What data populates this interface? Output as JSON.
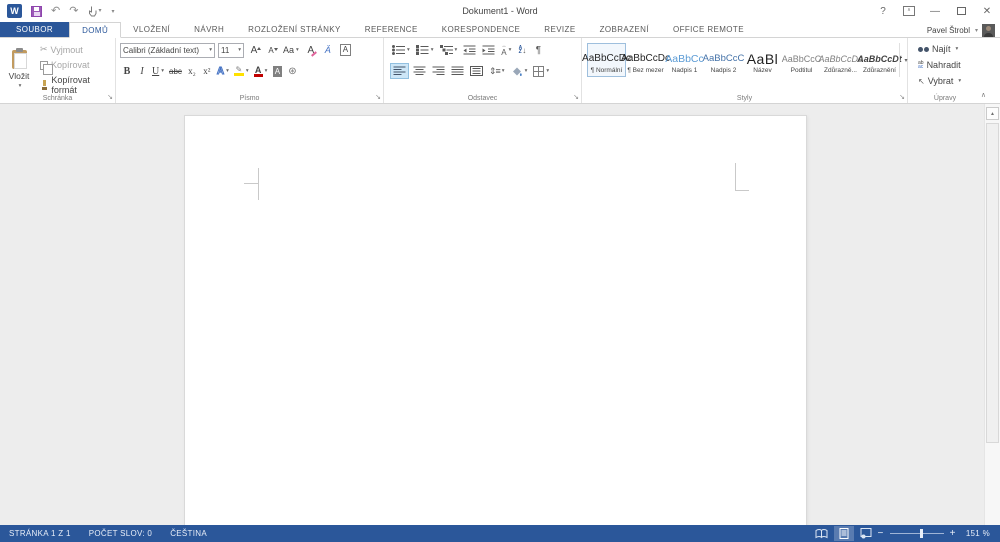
{
  "window": {
    "title": "Dokument1 - Word",
    "user_name": "Pavel Štrobl",
    "help": "?",
    "close": "✕",
    "minimize": "—"
  },
  "glyphs": {
    "undo": "↶",
    "redo": "↷",
    "dropdown": "▾",
    "collapse": "∧",
    "scroll_up": "▲",
    "launcher": "↘",
    "bold": "B",
    "italic": "I",
    "underline": "U",
    "strikethrough": "abc",
    "subscript": "x₂",
    "superscript": "x²",
    "grow_font": "A",
    "shrink_font": "A",
    "change_case": "Aa",
    "clear_format": "A",
    "phonetic": "Ä",
    "char_border": "A",
    "text_effects": "A",
    "highlight_pen": "✎",
    "font_color_a": "A",
    "char_shading": "A",
    "enclose": "⊛",
    "pilcrow": "¶",
    "scissors": "✂",
    "line_spacing": "⇕≡",
    "asian_top": "↔",
    "asian_a": "A",
    "sort_a": "A",
    "sort_z": "Z",
    "sort_arrow": "↓",
    "select_arrow": "↖",
    "replace_top": "ab",
    "replace_bottom": "ac",
    "zoom_out": "−",
    "zoom_in": "+"
  },
  "tabs": [
    {
      "label": "SOUBOR",
      "active": false
    },
    {
      "label": "DOMŮ",
      "active": true
    },
    {
      "label": "VLOŽENÍ",
      "active": false
    },
    {
      "label": "NÁVRH",
      "active": false
    },
    {
      "label": "ROZLOŽENÍ STRÁNKY",
      "active": false
    },
    {
      "label": "REFERENCE",
      "active": false
    },
    {
      "label": "KORESPONDENCE",
      "active": false
    },
    {
      "label": "REVIZE",
      "active": false
    },
    {
      "label": "ZOBRAZENÍ",
      "active": false
    },
    {
      "label": "OFFICE REMOTE",
      "active": false
    }
  ],
  "ribbon": {
    "clipboard": {
      "title": "Schránka",
      "paste": "Vložit",
      "cut": "Vyjmout",
      "copy": "Kopírovat",
      "format_painter": "Kopírovat formát"
    },
    "font": {
      "title": "Písmo",
      "name_value": "Calibri (Základní text)",
      "size_value": "11"
    },
    "paragraph": {
      "title": "Odstavec"
    },
    "styles": {
      "title": "Styly",
      "items": [
        {
          "preview": "AaBbCcDc",
          "label": "¶ Normální",
          "selected": true
        },
        {
          "preview": "AaBbCcDc",
          "label": "¶ Bez mezer",
          "selected": false
        },
        {
          "preview": "AaBbCc",
          "label": "Nadpis 1",
          "selected": false
        },
        {
          "preview": "AaBbCcC",
          "label": "Nadpis 2",
          "selected": false
        },
        {
          "preview": "AaBl",
          "label": "Název",
          "selected": false
        },
        {
          "preview": "AaBbCcC",
          "label": "Podtitul",
          "selected": false
        },
        {
          "preview": "AaBbCcDc",
          "label": "Zdůrazně...",
          "selected": false
        },
        {
          "preview": "AaBbCcDt",
          "label": "Zdůraznění",
          "selected": false
        }
      ]
    },
    "editing": {
      "title": "Úpravy",
      "find": "Najít",
      "replace": "Nahradit",
      "select": "Vybrat"
    }
  },
  "statusbar": {
    "page_info": "STRÁNKA 1 Z 1",
    "word_count": "POČET SLOV: 0",
    "language": "ČEŠTINA",
    "zoom_level": "151 %"
  },
  "colors": {
    "accent_blue": "#2b579a",
    "heading_blue": "#5b9bd5",
    "highlight_yellow": "#ffe100",
    "font_color_red": "#c00000",
    "doc_background": "#ededed"
  }
}
